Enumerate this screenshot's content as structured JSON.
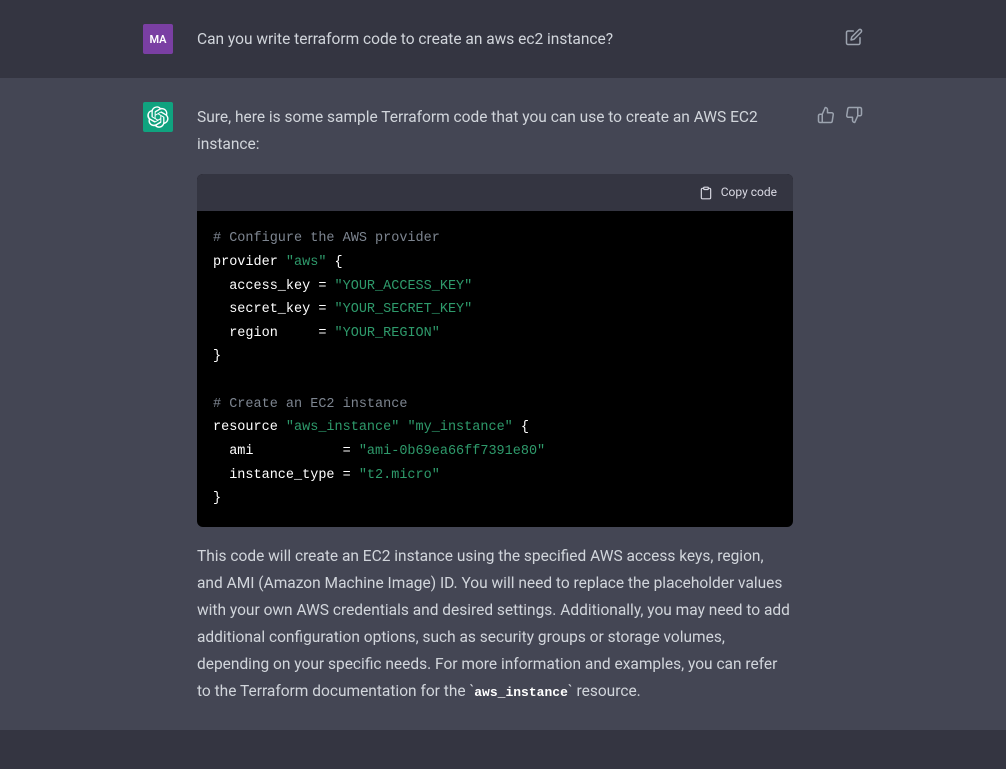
{
  "user": {
    "avatar_text": "MA",
    "message": "Can you write terraform code to create an aws ec2 instance?"
  },
  "assistant": {
    "intro": "Sure, here is some sample Terraform code that you can use to create an AWS EC2 instance:",
    "code": {
      "copy_label": "Copy code",
      "tokens": {
        "c1": "# Configure the AWS provider",
        "l2a": "provider ",
        "l2b": "\"aws\"",
        "l2c": " {",
        "l3a": "  access_key = ",
        "l3b": "\"YOUR_ACCESS_KEY\"",
        "l4a": "  secret_key = ",
        "l4b": "\"YOUR_SECRET_KEY\"",
        "l5a": "  region     = ",
        "l5b": "\"YOUR_REGION\"",
        "l6": "}",
        "c2": "# Create an EC2 instance",
        "l8a": "resource ",
        "l8b": "\"aws_instance\"",
        "l8c": " ",
        "l8d": "\"my_instance\"",
        "l8e": " {",
        "l9a": "  ami           = ",
        "l9b": "\"ami-0b69ea66ff7391e80\"",
        "l10a": "  instance_type = ",
        "l10b": "\"t2.micro\"",
        "l11": "}"
      }
    },
    "outro_a": "This code will create an EC2 instance using the specified AWS access keys, region, and AMI (Amazon Machine Image) ID. You will need to replace the placeholder values with your own AWS credentials and desired settings. Additionally, you may need to add additional configuration options, such as security groups or storage volumes, depending on your specific needs. For more information and examples, you can refer to the Terraform documentation for the ",
    "outro_code": "aws_instance",
    "outro_b": " resource."
  }
}
